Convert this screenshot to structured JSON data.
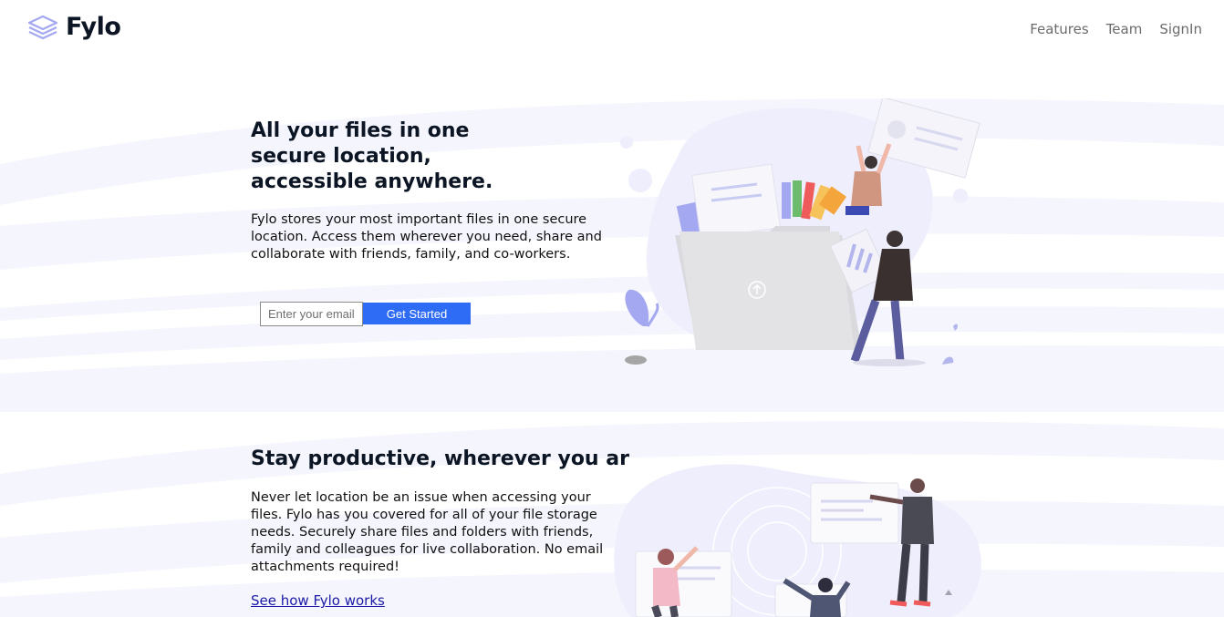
{
  "header": {
    "brand": "Fylo",
    "nav": [
      {
        "label": "Features"
      },
      {
        "label": "Team"
      },
      {
        "label": "SignIn"
      }
    ]
  },
  "hero": {
    "title": "All your files in one secure location, accessible anywhere.",
    "description": "Fylo stores your most important files in one secure location. Access them wherever you need, share and collaborate with friends, family, and co-workers.",
    "email_placeholder": "Enter your email",
    "cta_label": "Get Started"
  },
  "productive": {
    "title": "Stay productive, wherever you ar",
    "description": "Never let location be an issue when accessing your files. Fylo has you covered for all of your file storage needs. Securely share files and folders with friends, family and colleagues for live collaboration. No email attachments required!",
    "link_label": "See how Fylo works"
  },
  "colors": {
    "brand_dark": "#0c1524",
    "accent_blue": "#2f6cf6",
    "band": "#f5f5fd",
    "illustration_purple": "#a3a8f0"
  },
  "icons": [
    "layers-logo-icon"
  ]
}
